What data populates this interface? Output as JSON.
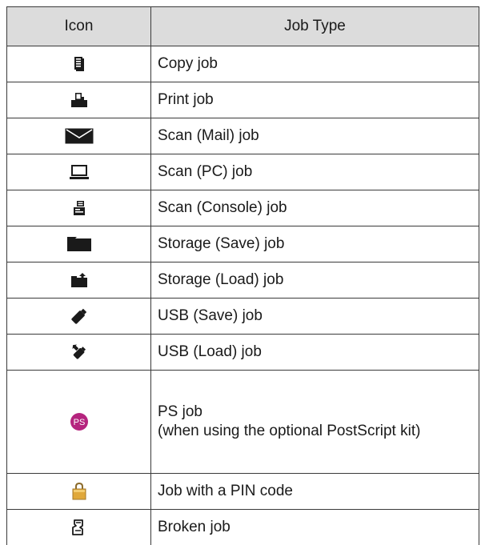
{
  "table": {
    "headers": {
      "icon": "Icon",
      "job_type": "Job Type"
    },
    "rows": [
      {
        "icon": "copy-job-icon",
        "label": "Copy job"
      },
      {
        "icon": "print-job-icon",
        "label": "Print job"
      },
      {
        "icon": "mail-envelope-icon",
        "label": "Scan (Mail) job"
      },
      {
        "icon": "laptop-pc-icon",
        "label": "Scan (PC) job"
      },
      {
        "icon": "scan-console-icon",
        "label": "Scan (Console) job"
      },
      {
        "icon": "folder-icon",
        "label": "Storage (Save) job"
      },
      {
        "icon": "folder-load-icon",
        "label": "Storage (Load) job"
      },
      {
        "icon": "usb-save-icon",
        "label": "USB (Save) job"
      },
      {
        "icon": "usb-load-icon",
        "label": "USB (Load) job"
      },
      {
        "icon": "postscript-ps-icon",
        "label": "PS job\n(when using the optional PostScript kit)"
      },
      {
        "icon": "pin-lock-icon",
        "label": "Job with a PIN code"
      },
      {
        "icon": "broken-job-icon",
        "label": "Broken job"
      }
    ]
  },
  "colors": {
    "header_bg": "#dcdcdc",
    "border": "#3a3a3a",
    "icon_dark": "#1a1a1a",
    "ps_badge": "#b5247e",
    "pin_gold": "#e0a83a"
  }
}
